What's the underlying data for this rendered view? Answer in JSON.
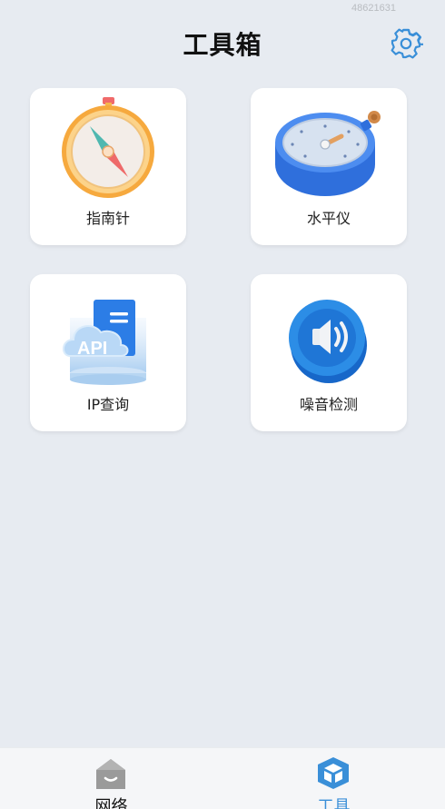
{
  "watermark": "48621631",
  "header": {
    "title": "工具箱",
    "settings_icon": "gear-icon"
  },
  "tools": [
    {
      "label": "指南针",
      "icon": "compass-icon"
    },
    {
      "label": "水平仪",
      "icon": "level-gauge-icon"
    },
    {
      "label": "IP查询",
      "icon": "api-cloud-icon"
    },
    {
      "label": "噪音检测",
      "icon": "speaker-icon"
    }
  ],
  "tabbar": {
    "tabs": [
      {
        "label": "网络",
        "icon": "house-icon",
        "active": false
      },
      {
        "label": "工具",
        "icon": "cube-icon",
        "active": true
      }
    ],
    "active_color": "#3a8fd8"
  },
  "colors": {
    "background": "#e7ebf1",
    "accent": "#3a8fd8"
  }
}
